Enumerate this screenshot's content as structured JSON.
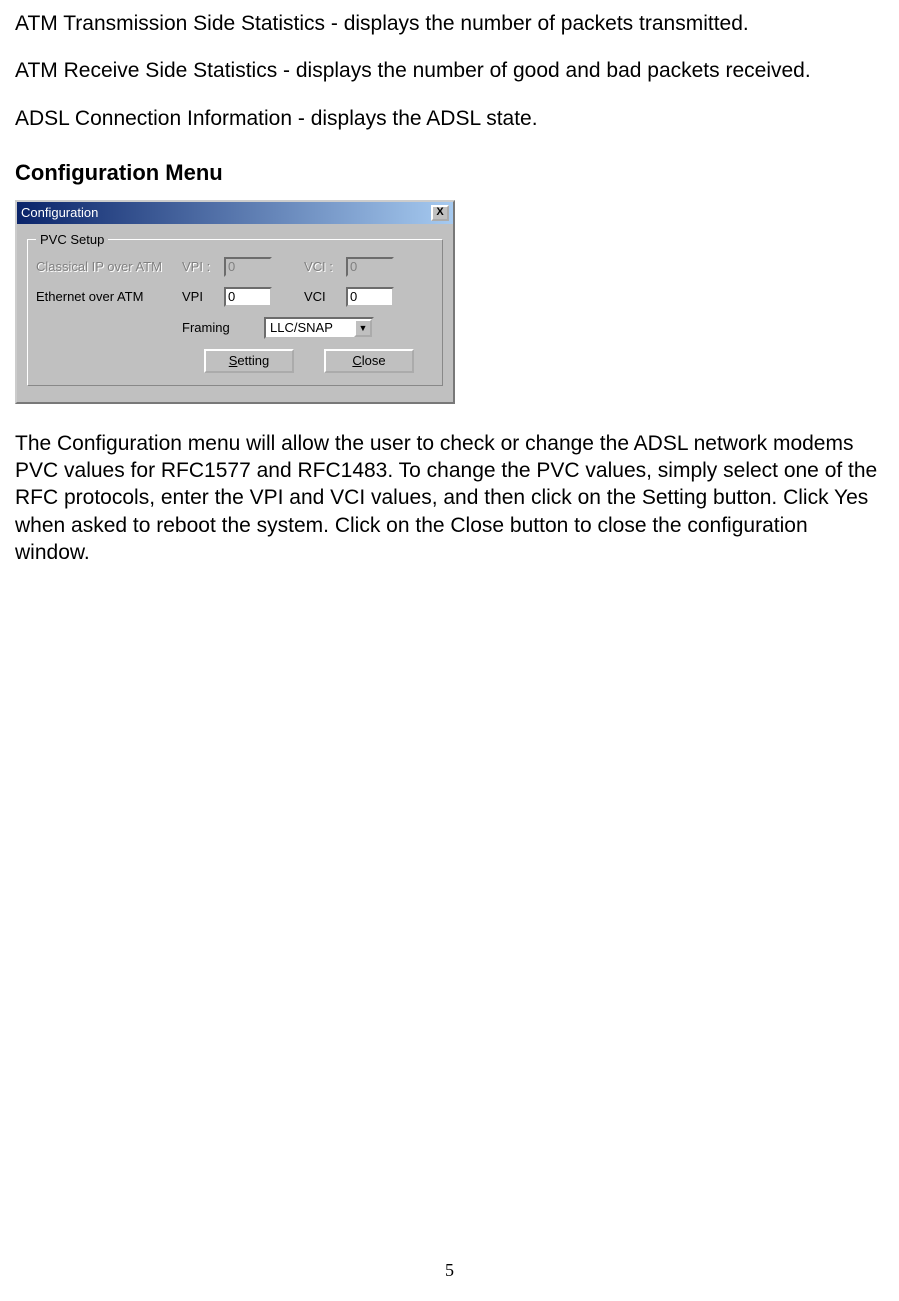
{
  "paragraphs": {
    "p1": "ATM Transmission Side Statistics - displays the number of packets transmitted.",
    "p2": "ATM Receive Side Statistics - displays the number of good and bad packets received.",
    "p3": "ADSL Connection Information - displays the ADSL state.",
    "heading": "Configuration Menu",
    "p4": "The Configuration menu will allow the user to check or change the ADSL network modems PVC values for RFC1577 and RFC1483.  To change the PVC values, simply select one of the RFC protocols, enter the VPI and VCI values, and then click on the Setting button.  Click Yes when asked to reboot the system.  Click on the Close button to close the configuration window."
  },
  "dialog": {
    "title": "Configuration",
    "close_x": "X",
    "groupbox_legend": "PVC Setup",
    "row1": {
      "label": "Classical IP over ATM",
      "vpi_label": "VPI :",
      "vpi_value": "0",
      "vci_label": "VCI :",
      "vci_value": "0"
    },
    "row2": {
      "label": "Ethernet over ATM",
      "vpi_label": "VPI",
      "vpi_value": "0",
      "vci_label": "VCI",
      "vci_value": "0"
    },
    "row3": {
      "label": "Framing",
      "select_value": "LLC/SNAP"
    },
    "buttons": {
      "setting": "Setting",
      "close": "Close"
    }
  },
  "page_number": "5"
}
